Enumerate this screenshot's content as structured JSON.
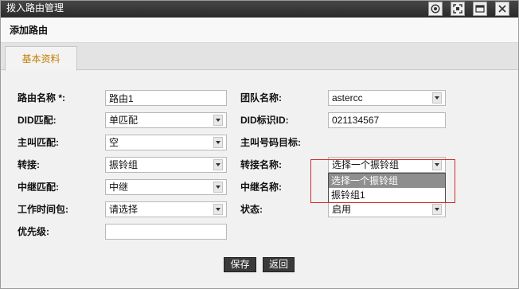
{
  "window": {
    "title": "拨入路由管理",
    "tools": [
      "target-icon",
      "fullscreen-icon",
      "window-icon",
      "close-icon"
    ]
  },
  "header": {
    "title": "添加路由"
  },
  "tabs": [
    {
      "label": "基本资料",
      "active": true
    }
  ],
  "form": {
    "left": [
      {
        "label": "路由名称 *:",
        "value": "路由1"
      },
      {
        "label": "DID匹配:",
        "value": "单匹配"
      },
      {
        "label": "主叫匹配:",
        "value": "空"
      },
      {
        "label": "转接:",
        "value": "振铃组"
      },
      {
        "label": "中继匹配:",
        "value": "中继"
      },
      {
        "label": "工作时间包:",
        "value": "请选择"
      },
      {
        "label": "优先级:",
        "value": ""
      }
    ],
    "right": [
      {
        "label": "团队名称:",
        "value": "astercc"
      },
      {
        "label": "DID标识ID:",
        "value": "021134567"
      },
      {
        "label": "主叫号码目标:"
      },
      {
        "label": "转接名称:",
        "value": "选择一个振铃组",
        "open": true,
        "options": [
          "选择一个振铃组",
          "振铃组1"
        ],
        "highlighted_option": 0
      },
      {
        "label": "中继名称:",
        "value": ""
      },
      {
        "label": "状态:",
        "value": "启用"
      }
    ]
  },
  "buttons": {
    "save": "保存",
    "back": "返回"
  },
  "colors": {
    "titlebar": "#333333",
    "tab_text": "#c47f00",
    "button_bg": "#3a3a3a",
    "option_highlight": "#8e8e8e",
    "annotation_box": "#d42a2a"
  }
}
